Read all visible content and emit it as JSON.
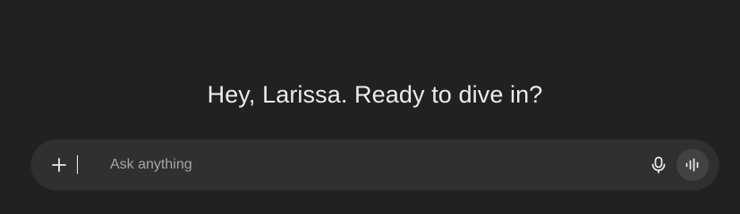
{
  "greeting": {
    "text": "Hey, Larissa. Ready to dive in?"
  },
  "composer": {
    "placeholder": "Ask anything",
    "value": "",
    "icons": {
      "add": "plus-icon",
      "dictate": "microphone-icon",
      "voice_mode": "voice-waveform-icon"
    }
  },
  "colors": {
    "background": "#212121",
    "composer_background": "#303030",
    "text_primary": "#ececec",
    "placeholder": "#a6a6a6",
    "voice_button": "#424242"
  }
}
